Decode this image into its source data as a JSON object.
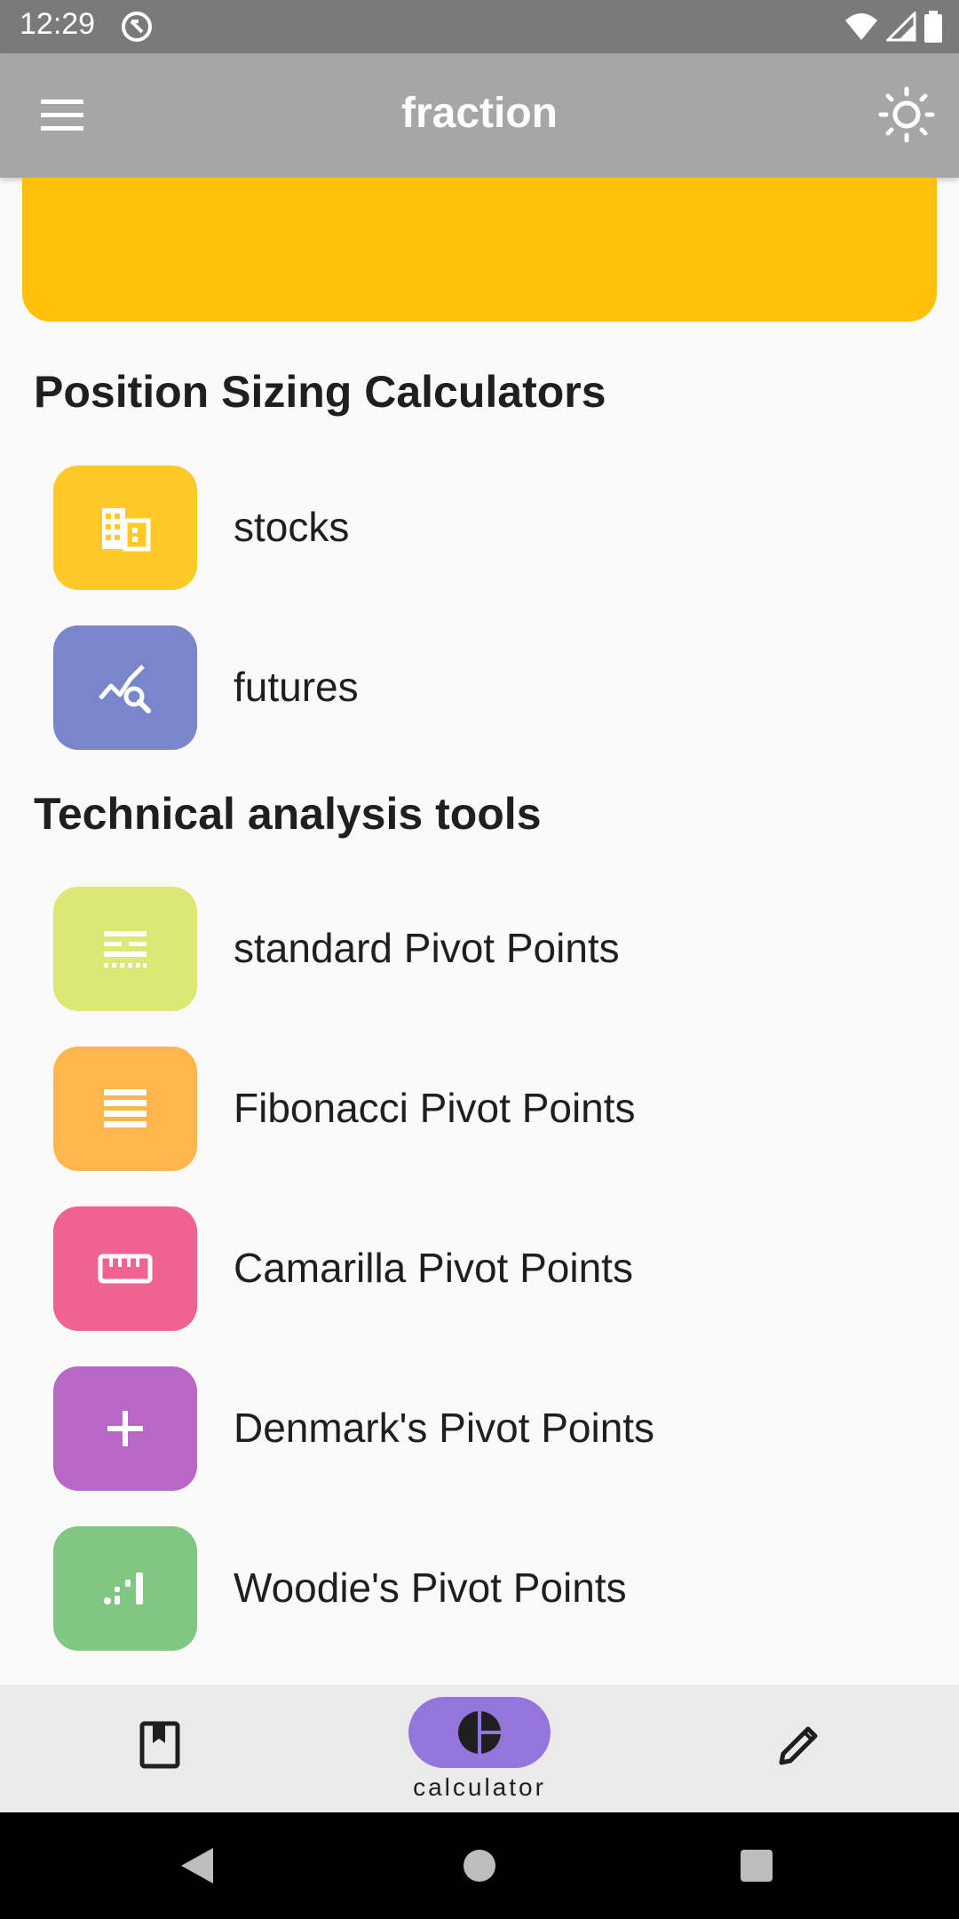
{
  "status_bar": {
    "time": "12:29"
  },
  "app_bar": {
    "title": "fraction"
  },
  "sections": [
    {
      "title": "Position Sizing Calculators"
    },
    {
      "title": "Technical analysis tools"
    }
  ],
  "position_items": [
    {
      "label": "stocks",
      "color": "#FFCA28",
      "icon": "building-icon"
    },
    {
      "label": "futures",
      "color": "#7986CB",
      "icon": "chart-search-icon"
    }
  ],
  "analysis_items": [
    {
      "label": "standard Pivot Points",
      "color": "#DCE775",
      "icon": "lines-dotted-icon"
    },
    {
      "label": "Fibonacci Pivot Points",
      "color": "#FFB74D",
      "icon": "stacked-lines-icon"
    },
    {
      "label": "Camarilla Pivot Points",
      "color": "#F06292",
      "icon": "ruler-icon"
    },
    {
      "label": "Denmark's Pivot Points",
      "color": "#BA68C8",
      "icon": "plus-icon"
    },
    {
      "label": "Woodie's Pivot Points",
      "color": "#81C784",
      "icon": "dots-bars-icon"
    }
  ],
  "bottom_nav": {
    "active_label": "calculator",
    "active_color": "#9475DB"
  },
  "colors": {
    "banner": "#FFC10A",
    "app_bar": "#A6A6A6",
    "status_bar": "#7A7A7A"
  }
}
